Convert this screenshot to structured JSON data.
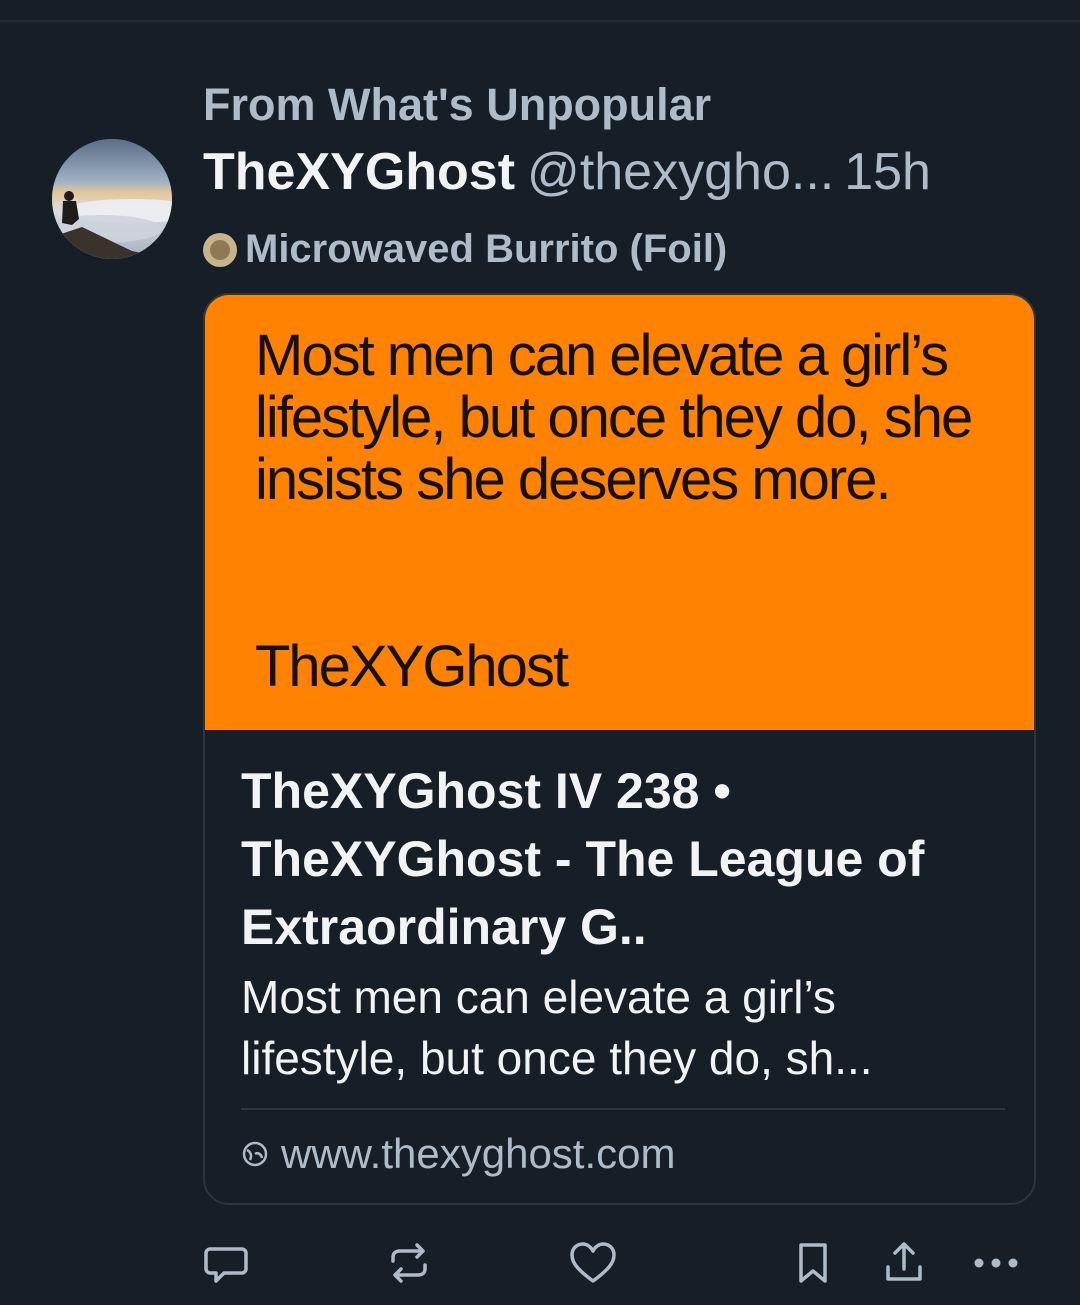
{
  "post": {
    "reason": "From What's Unpopular",
    "author_name": "TheXYGhost",
    "handle": "@thexygho...",
    "time": "15h",
    "feed_name": "Microwaved Burrito (Foil)"
  },
  "card": {
    "image_quote": "Most men can elevate a girl’s lifestyle, but once they do, she insists she deserves more.",
    "image_author": "TheXYGhost",
    "title": "TheXYGhost IV 238 • TheXYGhost - The League of Extraordinary G..",
    "description": "Most men can elevate a girl’s lifestyle, but once they do, sh...",
    "domain": "www.thexyghost.com"
  },
  "actions": {
    "icons": [
      "reply-icon",
      "repost-icon",
      "like-icon",
      "bookmark-icon",
      "share-icon",
      "more-icon"
    ]
  },
  "colors": {
    "background": "#161e27",
    "card_image": "#ff8200",
    "muted_text": "#aebbc9",
    "primary_text": "#f1f3f5"
  }
}
